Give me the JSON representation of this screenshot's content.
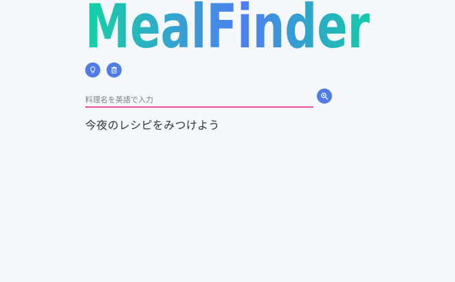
{
  "app": {
    "logo_text": "MealFinder",
    "logo_gradient": [
      "#12d3a4",
      "#4e7ef0",
      "#12cba8"
    ]
  },
  "toolbar": {
    "tip_icon": "lightbulb-icon",
    "clear_icon": "trash-icon",
    "button_color": "#4f7ce8"
  },
  "search": {
    "placeholder": "料理名を英語で入力",
    "value": "",
    "button_icon": "search-icon",
    "underline_color": "#e9519a"
  },
  "main": {
    "tagline": "今夜のレシピをみつけよう"
  }
}
